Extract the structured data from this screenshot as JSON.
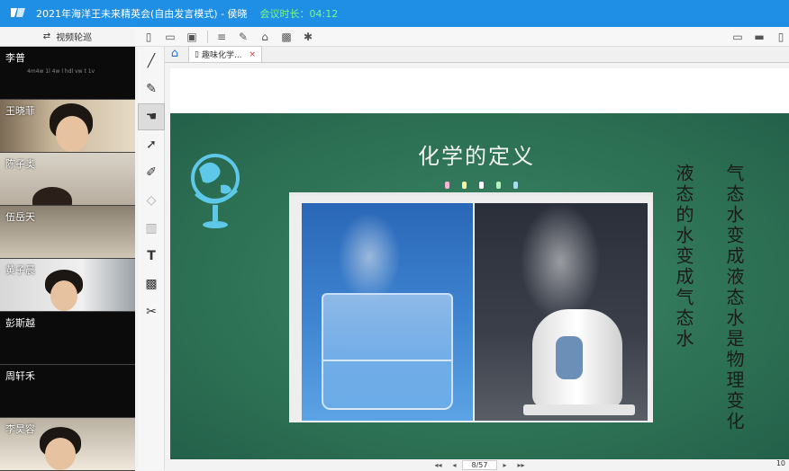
{
  "window": {
    "title": "2021年海洋王未来精英会(自由发言模式) - 侯晓",
    "timer": "会议时长：04:12"
  },
  "video_panel": {
    "toggle_label": "视频轮巡",
    "participants": [
      {
        "name": "李普",
        "subtext": "4m4w   1l   4w  l   hdl  vw  t    1v"
      },
      {
        "name": "王晓菲"
      },
      {
        "name": "陈子奥"
      },
      {
        "name": "伍岳天"
      },
      {
        "name": "黄子晨"
      },
      {
        "name": "彭斯越"
      },
      {
        "name": "周轩禾"
      },
      {
        "name": "李昊容"
      }
    ]
  },
  "tabs": {
    "doc_tab_label": "趣味化学...",
    "close_glyph": "×"
  },
  "slide": {
    "title": "化学的定义",
    "column_right": "气态水变成液态水是物理变化",
    "column_left": "液态的水变成气态水"
  },
  "nav": {
    "page_indicator": "8/57",
    "zoom": "10"
  },
  "colors": {
    "titlebar": "#1f8fe6",
    "slide_green": "#2b6e52",
    "timer_green": "#7CFC7C"
  }
}
